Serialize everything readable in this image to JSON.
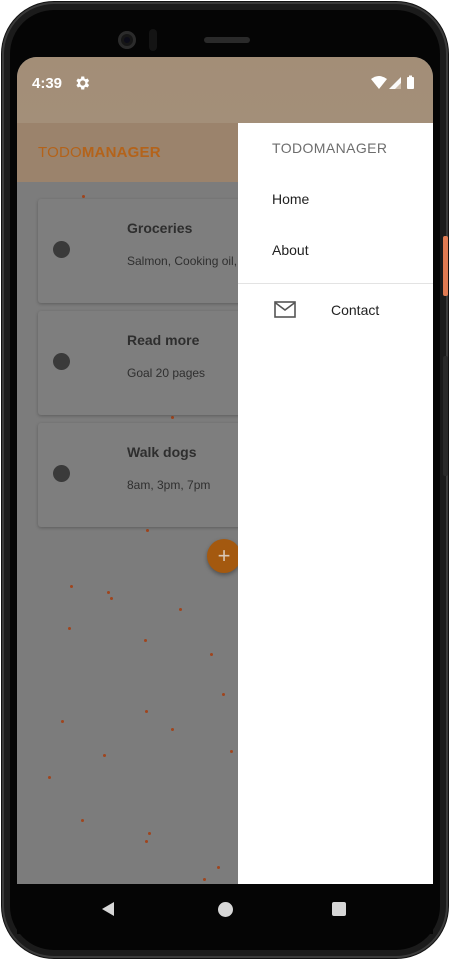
{
  "status_bar": {
    "time": "4:39",
    "settings_icon": "gear-icon",
    "wifi_icon": "wifi-icon",
    "signal_icon": "signal-icon",
    "battery_icon": "battery-icon"
  },
  "app_bar": {
    "title_part1": "TODO",
    "title_part2": "MANAGER"
  },
  "todos": [
    {
      "title": "Groceries",
      "subtitle": "Salmon, Cooking oil, F"
    },
    {
      "title": "Read more",
      "subtitle": "Goal 20 pages"
    },
    {
      "title": "Walk dogs",
      "subtitle": "8am, 3pm, 7pm"
    }
  ],
  "fab": {
    "label": "+"
  },
  "drawer": {
    "header": "TODOMANAGER",
    "items": [
      {
        "label": "Home"
      },
      {
        "label": "About"
      }
    ],
    "contact": {
      "label": "Contact",
      "icon": "mail-icon"
    }
  },
  "nav": {
    "back_icon": "back-triangle-icon",
    "home_icon": "home-circle-icon",
    "recents_icon": "recents-square-icon"
  },
  "colors": {
    "status_bar": "#a38e77",
    "accent": "#b4631a",
    "drawer_bg": "#ffffff",
    "scrim_content": "#7c7c7c"
  }
}
